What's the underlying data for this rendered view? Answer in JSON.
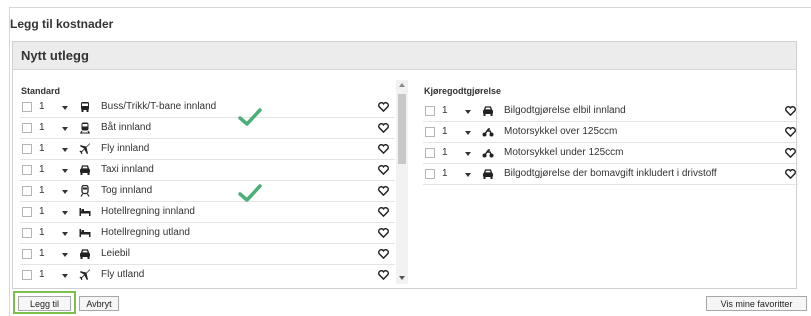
{
  "header": {
    "title": "Legg til kostnader"
  },
  "panel": {
    "title": "Nytt utlegg"
  },
  "standard": {
    "title": "Standard",
    "items": [
      {
        "qty": "1",
        "label": "Buss/Trikk/T-bane innland",
        "icon": "bus-icon",
        "checked_annotation": true
      },
      {
        "qty": "1",
        "label": "Båt innland",
        "icon": "train-icon"
      },
      {
        "qty": "1",
        "label": "Fly innland",
        "icon": "plane-icon"
      },
      {
        "qty": "1",
        "label": "Taxi innland",
        "icon": "car-icon"
      },
      {
        "qty": "1",
        "label": "Tog innland",
        "icon": "train-icon",
        "checked_annotation": true
      },
      {
        "qty": "1",
        "label": "Hotellregning innland",
        "icon": "bed-icon"
      },
      {
        "qty": "1",
        "label": "Hotellregning utland",
        "icon": "bed-icon"
      },
      {
        "qty": "1",
        "label": "Leiebil",
        "icon": "car-icon"
      },
      {
        "qty": "1",
        "label": "Fly utland",
        "icon": "plane-icon"
      }
    ]
  },
  "mileage": {
    "title": "Kjøregodtgjørelse",
    "items": [
      {
        "qty": "1",
        "label": "Bilgodtgjørelse elbil innland",
        "icon": "car-icon"
      },
      {
        "qty": "1",
        "label": "Motorsykkel over 125ccm",
        "icon": "motorcycle-icon"
      },
      {
        "qty": "1",
        "label": "Motorsykkel under 125ccm",
        "icon": "motorcycle-icon"
      },
      {
        "qty": "1",
        "label": "Bilgodtgjørelse der bomavgift inkludert i drivstoff",
        "icon": "car-icon"
      }
    ]
  },
  "footer": {
    "add_label": "Legg til",
    "cancel_label": "Avbryt",
    "favorites_label": "Vis mine favoritter"
  },
  "colors": {
    "check": "#4caf7a",
    "highlight": "#7cbf4a"
  }
}
